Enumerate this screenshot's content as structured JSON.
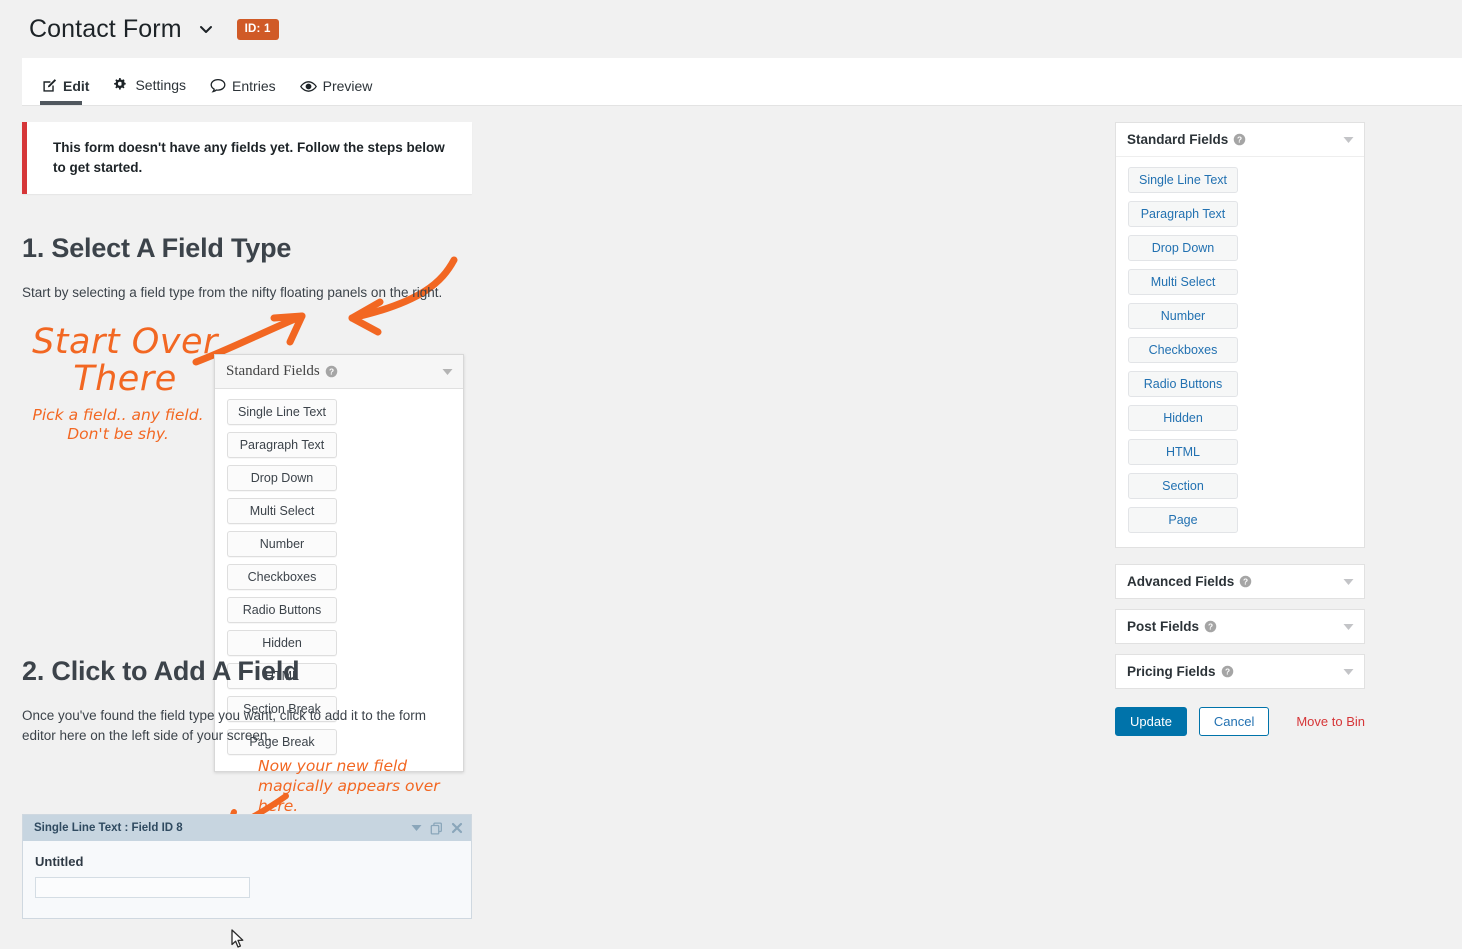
{
  "header": {
    "form_title": "Contact Form",
    "chevron_icon": "chevron-down-icon",
    "id_badge": "ID: 1"
  },
  "tabs": [
    {
      "label": "Edit",
      "icon": "edit-pencil-icon",
      "active": true
    },
    {
      "label": "Settings",
      "icon": "gears-icon",
      "active": false
    },
    {
      "label": "Entries",
      "icon": "speech-bubble-icon",
      "active": false
    },
    {
      "label": "Preview",
      "icon": "eye-icon",
      "active": false
    }
  ],
  "notice": {
    "text": "This form doesn't have any fields yet. Follow the steps below to get started.",
    "accent_color": "#d63638"
  },
  "steps": [
    {
      "heading": "1. Select A Field Type",
      "body": "Start by selecting a field type from the nifty floating panels on the right."
    },
    {
      "heading": "2. Click to Add A Field",
      "body": "Once you've found the field type you want, click to add it to the form editor here on the left side of your screen."
    }
  ],
  "annotations": {
    "start_over_there": "Start Over\nThere",
    "pick_a_field": "Pick a field.. any field.\nDon't be shy.",
    "appears_over_here": "Now your new field magically appears over here.",
    "ink_color": "#f26722"
  },
  "embedded_panel": {
    "title": "Standard Fields",
    "help_icon": "help-circle-icon",
    "caret_icon": "caret-down-icon",
    "buttons": [
      "Single Line Text",
      "Paragraph Text",
      "Drop Down",
      "Multi Select",
      "Number",
      "Checkboxes",
      "Radio Buttons",
      "Hidden",
      "HTML",
      "Section Break",
      "Page Break"
    ]
  },
  "field_card": {
    "title": "Single Line Text : Field ID 8",
    "label": "Untitled",
    "input_value": "",
    "icons": [
      "chevron-down-icon",
      "duplicate-icon",
      "close-icon"
    ],
    "cursor_icon": "mouse-pointer-icon"
  },
  "sidebar": {
    "panels": [
      {
        "title": "Standard Fields",
        "help_icon": "help-circle-icon",
        "caret_icon": "caret-down-icon",
        "expanded": true,
        "buttons": [
          "Single Line Text",
          "Paragraph Text",
          "Drop Down",
          "Multi Select",
          "Number",
          "Checkboxes",
          "Radio Buttons",
          "Hidden",
          "HTML",
          "Section",
          "Page"
        ]
      },
      {
        "title": "Advanced Fields",
        "help_icon": "help-circle-icon",
        "caret_icon": "caret-down-icon",
        "expanded": false,
        "buttons": []
      },
      {
        "title": "Post Fields",
        "help_icon": "help-circle-icon",
        "caret_icon": "caret-down-icon",
        "expanded": false,
        "buttons": []
      },
      {
        "title": "Pricing Fields",
        "help_icon": "help-circle-icon",
        "caret_icon": "caret-down-icon",
        "expanded": false,
        "buttons": []
      }
    ],
    "actions": {
      "update": "Update",
      "cancel": "Cancel",
      "move_to_bin": "Move to Bin",
      "update_color": "#0073aa",
      "bin_color": "#d63638"
    }
  }
}
